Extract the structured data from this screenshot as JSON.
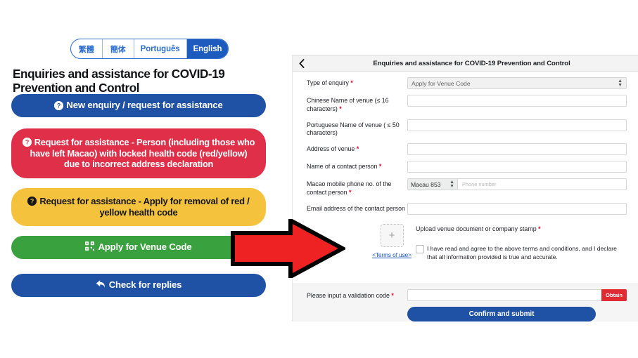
{
  "language_switcher": {
    "tabs": [
      {
        "label": "繁體",
        "active": false
      },
      {
        "label": "簡体",
        "active": false
      },
      {
        "label": "Português",
        "active": false
      },
      {
        "label": "English",
        "active": true
      }
    ]
  },
  "left": {
    "title": "Enquiries and assistance for COVID-19 Prevention and Control",
    "buttons": [
      {
        "label": "New enquiry / request for assistance",
        "icon": "question-circle-icon",
        "color": "#1f52a5"
      },
      {
        "label": "Request for assistance - Person (including those who have left Macao) with locked health code (red/yellow) due to incorrect address declaration",
        "icon": "question-circle-icon",
        "color": "#e03049"
      },
      {
        "label": "Request for assistance - Apply for removal of red / yellow health code",
        "icon": "question-circle-icon",
        "color": "#f4c23d"
      },
      {
        "label": "Apply for Venue Code",
        "icon": "qr-code-icon",
        "color": "#3aa13f"
      },
      {
        "label": "Check for replies",
        "icon": "reply-arrow-icon",
        "color": "#1f52a5"
      }
    ]
  },
  "arrow": {
    "name": "red-right-arrow",
    "fill": "#ee2222",
    "stroke": "#000000"
  },
  "form": {
    "header_title": "Enquiries and assistance for COVID-19 Prevention and Control",
    "back_icon": "back-chevron-icon",
    "fields": [
      {
        "label": "Type of enquiry",
        "required": true,
        "type": "select",
        "value": "Apply for Venue Code"
      },
      {
        "label": "Chinese Name of venue (≤ 16 characters)",
        "required": true,
        "type": "text",
        "value": ""
      },
      {
        "label": "Portuguese Name of venue ( ≤ 50 characters)",
        "required": false,
        "type": "text",
        "value": ""
      },
      {
        "label": "Address of venue",
        "required": true,
        "type": "text",
        "value": ""
      },
      {
        "label": "Name of a contact person",
        "required": true,
        "type": "text",
        "value": ""
      },
      {
        "label": "Macao mobile phone no. of the contact person",
        "required": true,
        "type": "phone",
        "country_code": "Macau 853",
        "placeholder": "Phone number",
        "value": ""
      },
      {
        "label": "Email address of the contact person",
        "required": false,
        "type": "text",
        "value": ""
      }
    ],
    "upload": {
      "box_icon": "plus-icon",
      "terms_link": "<Terms of use>",
      "caption": "Upload venue document or company stamp",
      "caption_required": true
    },
    "consent": {
      "checked": false,
      "text": "I have read and agree to the above terms and conditions, and I declare that all information provided is true and accurate."
    },
    "validation": {
      "label": "Please input a validation code",
      "required": true,
      "value": "",
      "obtain_label": "Obtain"
    },
    "submit_label": "Confirm and submit"
  }
}
